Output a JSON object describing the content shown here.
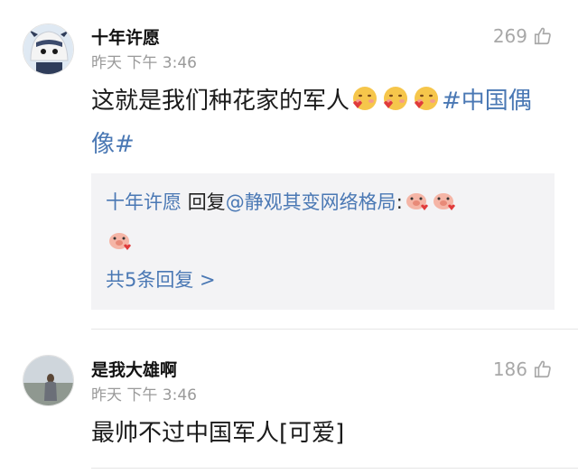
{
  "comments": [
    {
      "username": "十年许愿",
      "timestamp": "昨天 下午 3:46",
      "likes": "269",
      "text": "这就是我们种花家的军人",
      "hashtag": "#中国偶像#",
      "emoji_names": [
        "blush-heart-emoji",
        "blush-heart-emoji",
        "blush-heart-emoji"
      ],
      "reply": {
        "author": "十年许愿",
        "verb": "回复",
        "mention": "@静观其变网络格局",
        "colon": ":",
        "emoji_names": [
          "pig-heart-emoji",
          "pig-heart-emoji",
          "pig-heart-emoji"
        ],
        "more": "共5条回复 >"
      }
    },
    {
      "username": "是我大雄啊",
      "timestamp": "昨天 下午 3:46",
      "likes": "186",
      "text": "最帅不过中国军人[可爱]"
    }
  ],
  "icons": {
    "like": "thumbs-up-icon"
  },
  "colors": {
    "link": "#4a78b4",
    "muted": "#9a9a9a",
    "reply_bg": "#f3f3f5"
  }
}
